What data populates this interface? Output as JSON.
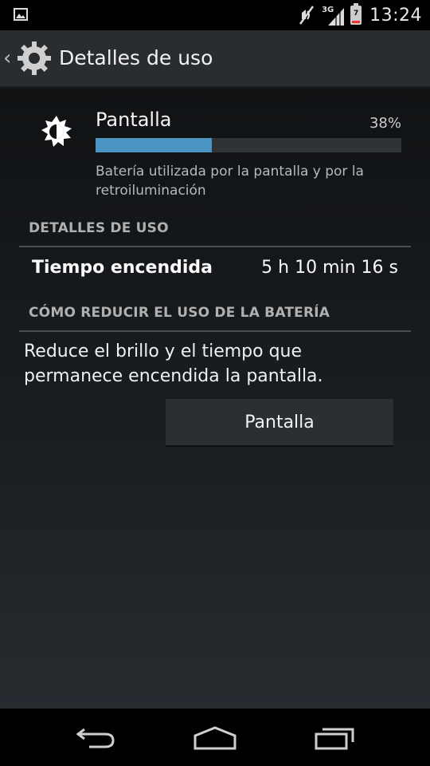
{
  "status_bar": {
    "network": "3G",
    "battery_level": "7",
    "time": "13:24",
    "icons": [
      "gallery-icon",
      "mute-icon",
      "signal-icon",
      "battery-icon"
    ]
  },
  "action_bar": {
    "title": "Detalles de uso",
    "icon": "settings-gear-icon"
  },
  "usage_item": {
    "name": "Pantalla",
    "percent_text": "38%",
    "percent_value": 38,
    "description": "Batería utilizada por la pantalla y por la retroiluminación",
    "icon": "brightness-icon",
    "bar_color": "#4b95c4"
  },
  "details_section": {
    "header": "DETALLES DE USO",
    "label": "Tiempo encendida",
    "value": "5 h 10 min 16 s"
  },
  "reduce_section": {
    "header": "CÓMO REDUCIR EL USO DE LA BATERÍA",
    "text": "Reduce el brillo y el tiempo que permanece encendida la pantalla.",
    "button_label": "Pantalla"
  },
  "nav_bar": {
    "buttons": [
      "back-icon",
      "home-icon",
      "recents-icon"
    ]
  }
}
